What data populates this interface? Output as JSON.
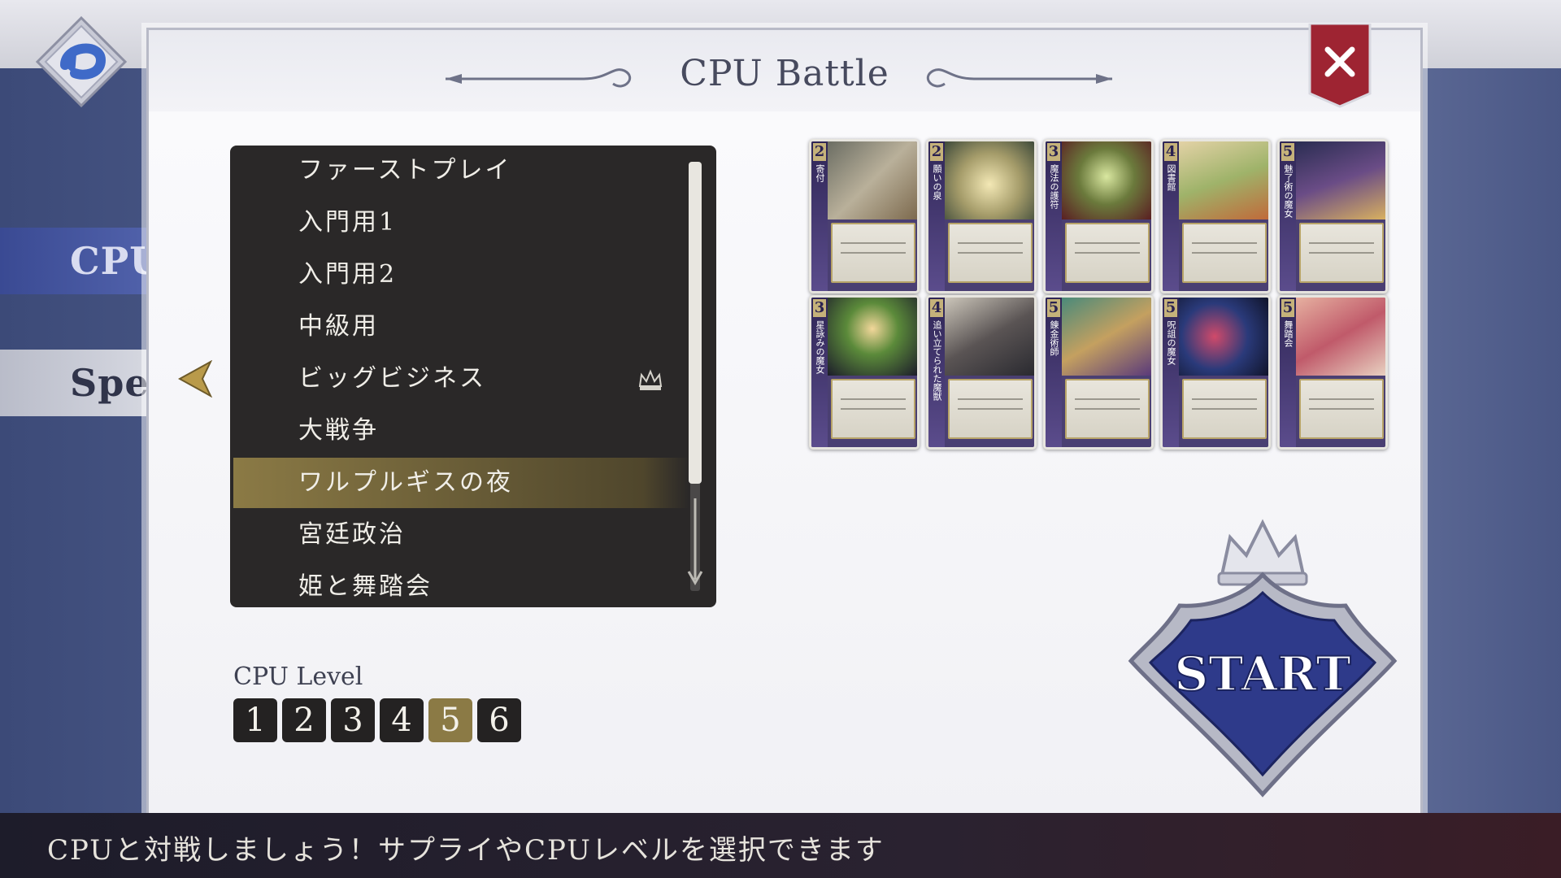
{
  "title": "CPU Battle",
  "side_tabs": [
    "CPU",
    "Spe"
  ],
  "list": {
    "items": [
      "ファーストプレイ",
      "入門用1",
      "入門用2",
      "中級用",
      "ビッグビジネス",
      "大戦争",
      "ワルプルギスの夜",
      "宮廷政治",
      "姫と舞踏会"
    ],
    "selected_index": 6,
    "crown_index": 4
  },
  "cards": [
    {
      "cost": "2",
      "name": "寄付"
    },
    {
      "cost": "2",
      "name": "願いの泉"
    },
    {
      "cost": "3",
      "name": "魔法の護符"
    },
    {
      "cost": "4",
      "name": "図書館"
    },
    {
      "cost": "5",
      "name": "魅了術の魔女"
    },
    {
      "cost": "3",
      "name": "星詠みの魔女"
    },
    {
      "cost": "4",
      "name": "追い立てられた魔獣"
    },
    {
      "cost": "5",
      "name": "錬金術師"
    },
    {
      "cost": "5",
      "name": "呪詛の魔女"
    },
    {
      "cost": "5",
      "name": "舞踏会"
    }
  ],
  "cpu_level": {
    "label": "CPU Level",
    "levels": [
      "1",
      "2",
      "3",
      "4",
      "5",
      "6"
    ],
    "selected": "5"
  },
  "start_label": "START",
  "footer": "CPUと対戦しましょう！サプライやCPUレベルを選択できます",
  "colors": {
    "accent": "#8b7a45",
    "list_bg": "#2a2828",
    "close_red": "#9e2432",
    "start_blue": "#2e3a8a"
  }
}
